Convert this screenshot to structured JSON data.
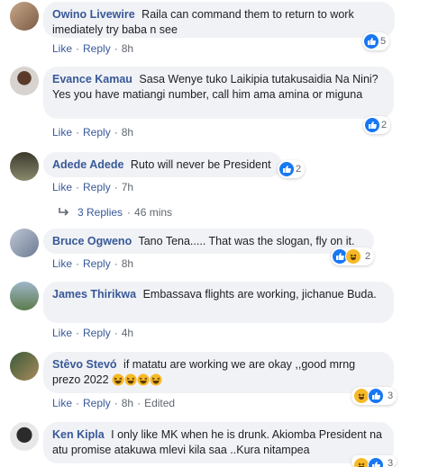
{
  "action_labels": {
    "like": "Like",
    "reply": "Reply",
    "separator": "·"
  },
  "comments": [
    {
      "author": "Owino Livewire",
      "text": "Raila can command them to return to work imediately try baba n see",
      "time": "8h",
      "reaction_count": "5",
      "reactions": [
        "like"
      ]
    },
    {
      "author": "Evance Kamau",
      "text": "Sasa Wenye tuko Laikipia tutakusaidia Na Nini? Yes you have matiangi number, call him ama amina or miguna",
      "time": "8h",
      "reaction_count": "2",
      "reactions": [
        "like"
      ]
    },
    {
      "author": "Adede Adede",
      "text": "Ruto will never be President",
      "time": "7h",
      "reaction_count": "2",
      "reactions": [
        "like"
      ]
    },
    {
      "author": "Bruce Ogweno",
      "text": "Tano Tena..... That was the slogan, fly on it.",
      "time": "8h",
      "reaction_count": "2",
      "reactions": [
        "like",
        "haha"
      ]
    },
    {
      "author": "James Thirikwa",
      "text": "Embassava flights are working, jichanue Buda.",
      "time": "4h",
      "reaction_count": "",
      "reactions": []
    },
    {
      "author": "Stêvo Stevó",
      "text": "if matatu are working we are okay ,,good mrng prezo 2022",
      "time": "8h",
      "edited": "Edited",
      "reaction_count": "3",
      "reactions": [
        "haha",
        "like"
      ]
    },
    {
      "author": "Ken Kipla",
      "text": "I only like MK when he is drunk. Akiomba President na atu promise atakuwa mlevi kila saa ..Kura nitampea",
      "time": "",
      "reaction_count": "3",
      "reactions": [
        "haha",
        "like"
      ]
    }
  ],
  "replies_link": {
    "label": "3 Replies",
    "time": "46 mins"
  },
  "colors": {
    "link": "#385898",
    "bubble": "#f0f2f5",
    "like": "#1877f2",
    "haha": "#f7b928",
    "meta": "#606770"
  }
}
